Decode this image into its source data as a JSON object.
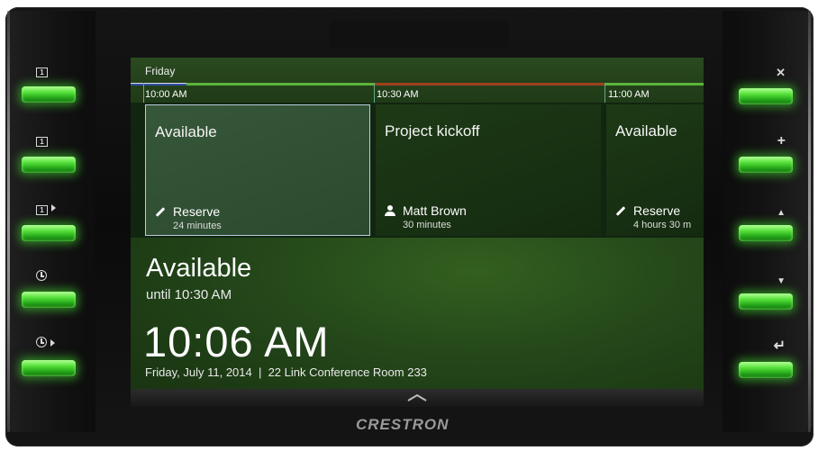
{
  "brand": "CRESTRON",
  "timeline": {
    "day": "Friday",
    "times": [
      "10:00 AM",
      "10:30 AM",
      "11:00 AM"
    ]
  },
  "slots": [
    {
      "title": "Available",
      "action": "Reserve",
      "duration": "24 minutes",
      "icon": "pencil-icon",
      "selected": true
    },
    {
      "title": "Project kickoff",
      "action": "Matt Brown",
      "duration": "30 minutes",
      "icon": "person-icon",
      "selected": false
    },
    {
      "title": "Available",
      "action": "Reserve",
      "duration": "4 hours 30 m",
      "icon": "pencil-icon",
      "selected": false
    }
  ],
  "status": {
    "label": "Available",
    "until": "until 10:30 AM",
    "clock": "10:06 AM",
    "info": "Friday, July 11, 2014  |  22 Link Conference Room 233"
  },
  "left_buttons": [
    {
      "icon": "calendar-day-icon",
      "glyph": "1"
    },
    {
      "icon": "calendar-day-icon",
      "glyph": "1"
    },
    {
      "icon": "calendar-next-icon",
      "glyph": "1"
    },
    {
      "icon": "clock-icon",
      "glyph": ""
    },
    {
      "icon": "clock-next-icon",
      "glyph": ""
    }
  ],
  "right_buttons": [
    {
      "icon": "close-icon",
      "glyph": "✕"
    },
    {
      "icon": "plus-icon",
      "glyph": "+"
    },
    {
      "icon": "up-arrow-icon",
      "glyph": "▲"
    },
    {
      "icon": "down-arrow-icon",
      "glyph": "▼"
    },
    {
      "icon": "enter-icon",
      "glyph": "↵"
    }
  ],
  "colors": {
    "accent_green": "#58e23c",
    "bar_blue": "#2f4fa8",
    "bar_red": "#a0401e",
    "bar_green": "#5db33a"
  }
}
